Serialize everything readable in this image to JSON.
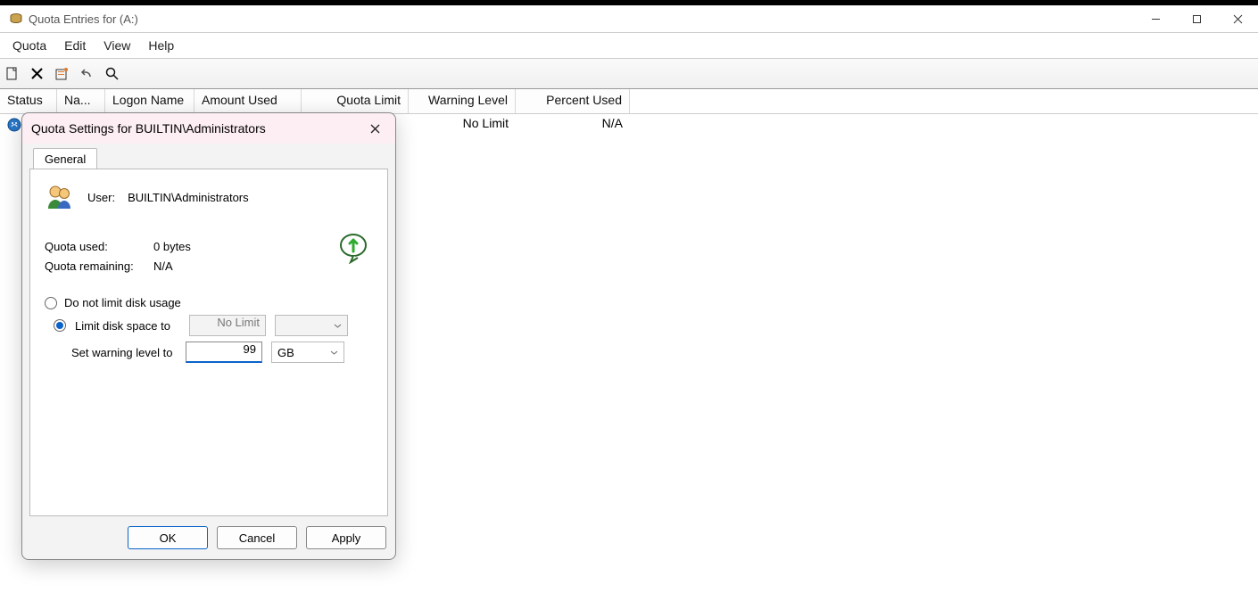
{
  "window": {
    "title": "Quota Entries for  (A:)"
  },
  "menu": {
    "quota": "Quota",
    "edit": "Edit",
    "view": "View",
    "help": "Help"
  },
  "columns": {
    "status": "Status",
    "name": "Na...",
    "logon": "Logon Name",
    "amount": "Amount Used",
    "quota": "Quota Limit",
    "warn": "Warning Level",
    "pct": "Percent Used"
  },
  "row0": {
    "warn": "No Limit",
    "pct": "N/A"
  },
  "dialog": {
    "title": "Quota Settings for BUILTIN\\Administrators",
    "tab": "General",
    "user_label": "User:",
    "user_value": "BUILTIN\\Administrators",
    "quota_used_label": "Quota used:",
    "quota_used_value": "0 bytes",
    "quota_remaining_label": "Quota remaining:",
    "quota_remaining_value": "N/A",
    "opt_nolimit": "Do not limit disk usage",
    "opt_limit": "Limit disk space to",
    "limit_value": "No Limit",
    "limit_unit": "",
    "warn_label": "Set warning level to",
    "warn_value": "99",
    "warn_unit": "GB",
    "ok": "OK",
    "cancel": "Cancel",
    "apply": "Apply"
  }
}
